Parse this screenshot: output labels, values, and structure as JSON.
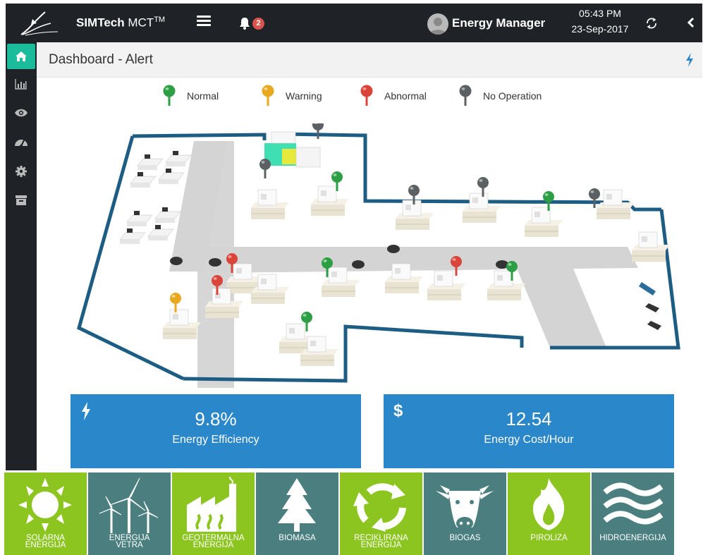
{
  "topbar": {
    "brand_bold": "SIMTech",
    "brand_light": " MCT",
    "brand_sup": "TM",
    "notification_count": "2",
    "user_name": "Energy Manager",
    "time": "05:43 PM",
    "date": "23-Sep-2017"
  },
  "sidebar": {
    "items": [
      {
        "icon": "home-icon",
        "active": true
      },
      {
        "icon": "bar-chart-icon"
      },
      {
        "icon": "eye-icon"
      },
      {
        "icon": "dashboard-gauge-icon"
      },
      {
        "icon": "gear-icon"
      },
      {
        "icon": "archive-icon"
      }
    ]
  },
  "header": {
    "title": "Dashboard - Alert"
  },
  "legend": [
    {
      "label": "Normal",
      "color": "#2e9e45"
    },
    {
      "label": "Warning",
      "color": "#e8a820"
    },
    {
      "label": "Abnormal",
      "color": "#d9453b"
    },
    {
      "label": "No Operation",
      "color": "#5b6063"
    }
  ],
  "kpis": [
    {
      "icon": "bolt-icon",
      "symbol": "ϟ",
      "value": "9.8%",
      "label": "Energy Efficiency"
    },
    {
      "icon": "dollar-icon",
      "symbol": "$",
      "value": "12.54",
      "label": "Energy Cost/Hour"
    }
  ],
  "tiles": [
    {
      "label_1": "Solarna",
      "label_2": "Energija",
      "color": "green",
      "icon": "sun-icon"
    },
    {
      "label_1": "Energija",
      "label_2": "Vetra",
      "color": "teal",
      "icon": "wind-turbine-icon"
    },
    {
      "label_1": "Geotermalna",
      "label_2": "Energija",
      "color": "green",
      "icon": "geothermal-icon"
    },
    {
      "label_1": "Biomasa",
      "label_2": "",
      "color": "teal",
      "icon": "tree-icon"
    },
    {
      "label_1": "Reciklirana",
      "label_2": "Energija",
      "color": "green",
      "icon": "recycle-icon"
    },
    {
      "label_1": "Biogas",
      "label_2": "",
      "color": "teal",
      "icon": "cow-icon"
    },
    {
      "label_1": "Piroliza",
      "label_2": "",
      "color": "green",
      "icon": "flame-icon"
    },
    {
      "label_1": "Hidroenergija",
      "label_2": "",
      "color": "teal",
      "icon": "waves-icon"
    }
  ]
}
